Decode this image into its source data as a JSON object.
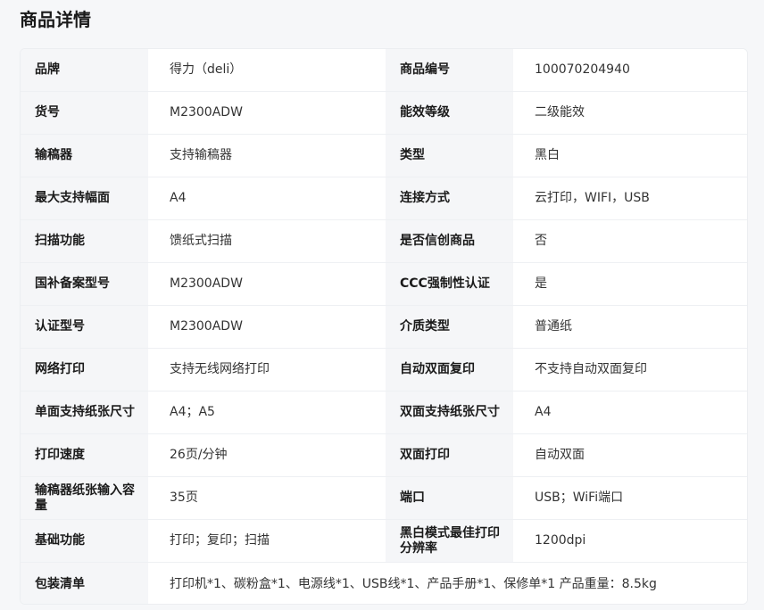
{
  "section": {
    "title": "商品详情"
  },
  "specs": [
    {
      "k1": "品牌",
      "v1": "得力（deli）",
      "k2": "商品编号",
      "v2": "100070204940"
    },
    {
      "k1": "货号",
      "v1": "M2300ADW",
      "k2": "能效等级",
      "v2": "二级能效"
    },
    {
      "k1": "输稿器",
      "v1": "支持输稿器",
      "k2": "类型",
      "v2": "黑白"
    },
    {
      "k1": "最大支持幅面",
      "v1": "A4",
      "k2": "连接方式",
      "v2": "云打印，WIFI，USB"
    },
    {
      "k1": "扫描功能",
      "v1": "馈纸式扫描",
      "k2": "是否信创商品",
      "v2": "否"
    },
    {
      "k1": "国补备案型号",
      "v1": "M2300ADW",
      "k2": "CCC强制性认证",
      "v2": "是"
    },
    {
      "k1": "认证型号",
      "v1": "M2300ADW",
      "k2": "介质类型",
      "v2": "普通纸"
    },
    {
      "k1": "网络打印",
      "v1": "支持无线网络打印",
      "k2": "自动双面复印",
      "v2": "不支持自动双面复印"
    },
    {
      "k1": "单面支持纸张尺寸",
      "v1": "A4；A5",
      "k2": "双面支持纸张尺寸",
      "v2": "A4"
    },
    {
      "k1": "打印速度",
      "v1": "26页/分钟",
      "k2": "双面打印",
      "v2": "自动双面"
    },
    {
      "k1": "输稿器纸张输入容量",
      "v1": "35页",
      "k2": "端口",
      "v2": "USB；WiFi端口"
    },
    {
      "k1": "基础功能",
      "v1": "打印；复印；扫描",
      "k2": "黑白模式最佳打印分辨率",
      "v2": "1200dpi"
    }
  ],
  "packing": {
    "label": "包装清单",
    "value": "打印机*1、碳粉盒*1、电源线*1、USB线*1、产品手册*1、保修单*1 产品重量：8.5kg"
  }
}
